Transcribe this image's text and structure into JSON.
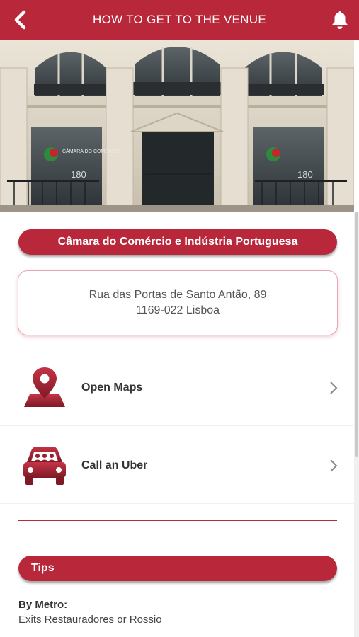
{
  "header": {
    "title": "HOW TO GET TO THE VENUE",
    "back_icon": "chevron-left-icon",
    "bell_icon": "bell-icon",
    "color": "#b8283a"
  },
  "hero": {
    "image": "venue-building-photo",
    "banner_left": "CÂMARA DO COMÉRCIO",
    "banner_left_number": "180",
    "banner_right_number": "180"
  },
  "venue": {
    "name": "Câmara do Comércio e Indústria Portuguesa",
    "address_line1": "Rua das Portas de Santo Antão, 89",
    "address_line2": "1169-022 Lisboa"
  },
  "actions": [
    {
      "label": "Open Maps",
      "icon": "map-pin-icon"
    },
    {
      "label": "Call an Uber",
      "icon": "car-icon"
    }
  ],
  "tips": {
    "title": "Tips",
    "metro_heading": "By Metro:",
    "metro_text": "Exits Restauradores or Rossio"
  }
}
